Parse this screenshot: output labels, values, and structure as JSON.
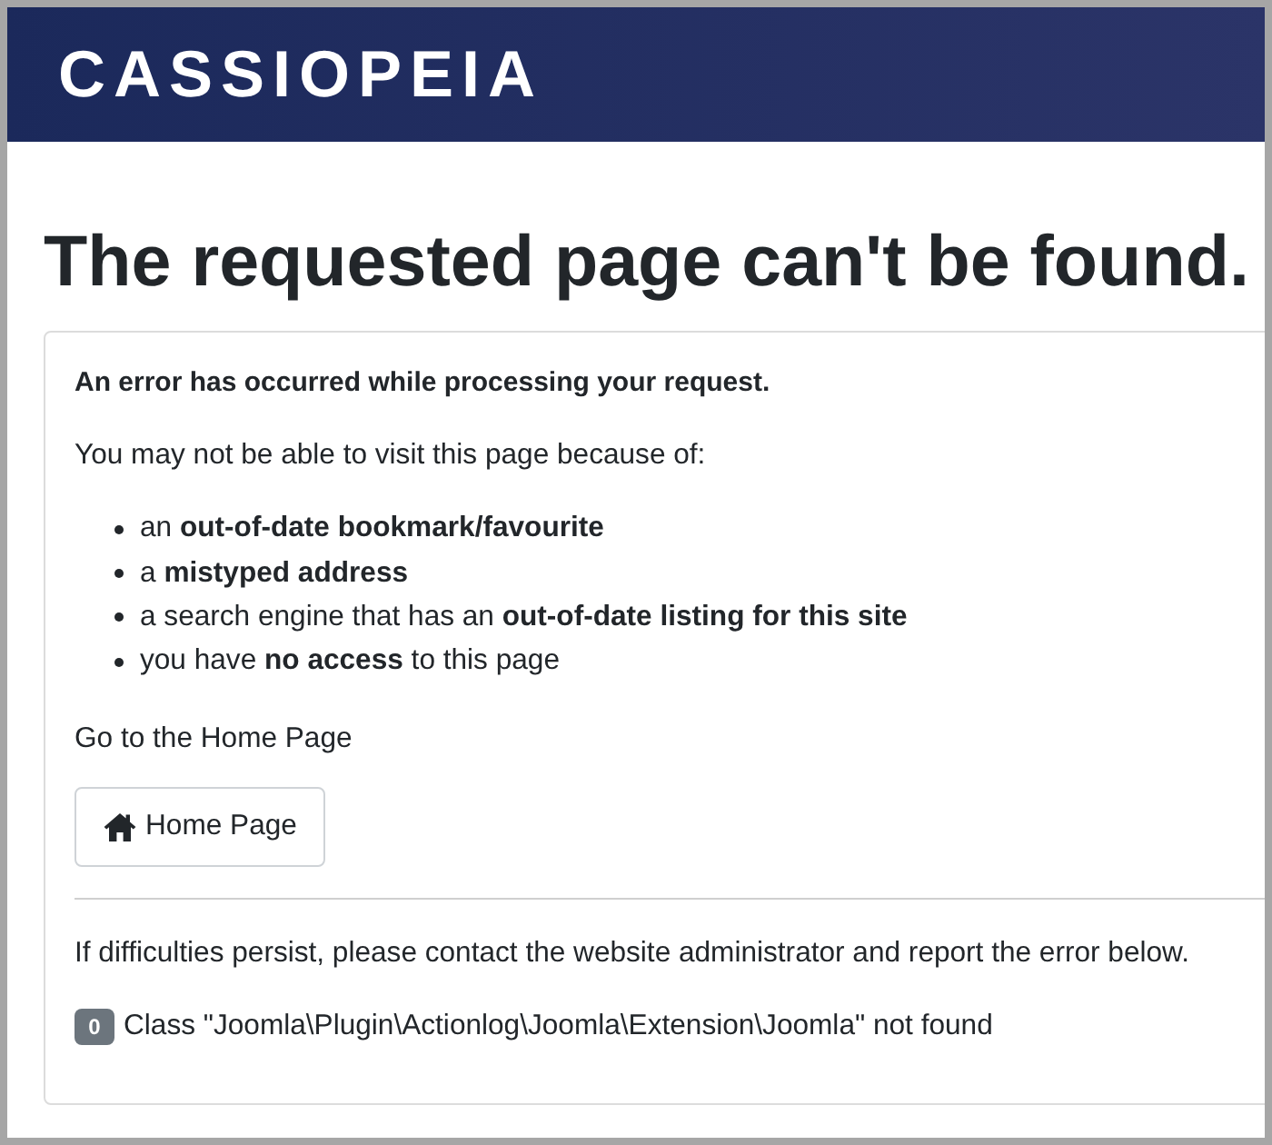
{
  "header": {
    "logo": "CASSIOPEIA"
  },
  "heading": "The requested page can't be found.",
  "card": {
    "lead": "An error has occurred while processing your request.",
    "intro": "You may not be able to visit this page because of:",
    "reasons": [
      "an **out-of-date bookmark/favourite**",
      "a **mistyped address**",
      "a search engine that has an **out-of-date listing for this site**",
      "you have **no access** to this page"
    ],
    "home_prompt": "Go to the Home Page",
    "home_button": "Home Page",
    "contact_note": "If difficulties persist, please contact the website administrator and report the error below.",
    "error": {
      "code": "0",
      "message": "Class \"Joomla\\Plugin\\Actionlog\\Joomla\\Extension\\Joomla\" not found"
    }
  }
}
